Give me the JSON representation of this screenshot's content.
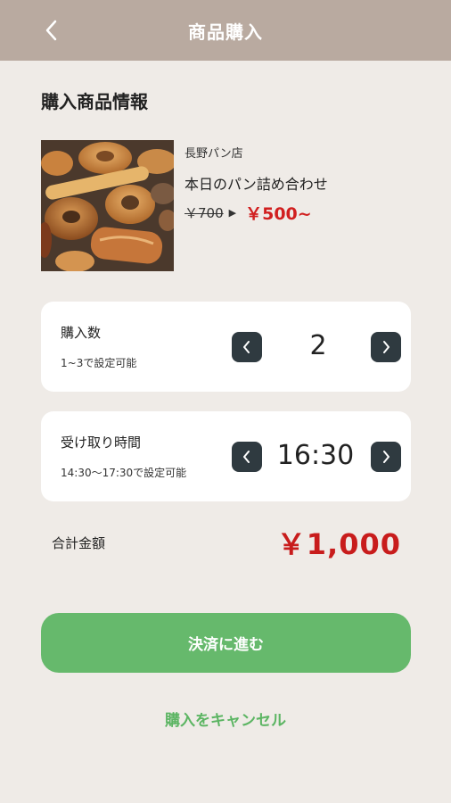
{
  "header": {
    "title": "商品購入",
    "back_icon": "chevron-left-icon"
  },
  "section": {
    "title": "購入商品情報"
  },
  "product": {
    "shop_name": "長野パン店",
    "name": "本日のパン詰め合わせ",
    "old_price": "￥700",
    "arrow": "▶",
    "new_price": "￥500~"
  },
  "quantity": {
    "label": "購入数",
    "sub": "1~3で設定可能",
    "value": "2"
  },
  "pickup_time": {
    "label": "受け取り時間",
    "sub": "14:30〜17:30で設定可能",
    "value": "16:30"
  },
  "total": {
    "label": "合計金額",
    "value": "￥1,000"
  },
  "actions": {
    "pay_label": "決済に進む",
    "cancel_label": "購入をキャンセル"
  },
  "colors": {
    "header_bg": "#b9aaa0",
    "page_bg": "#efebe7",
    "price_red": "#d11f1f",
    "button_green": "#66b96c",
    "stepper_dark": "#2f3a40"
  }
}
